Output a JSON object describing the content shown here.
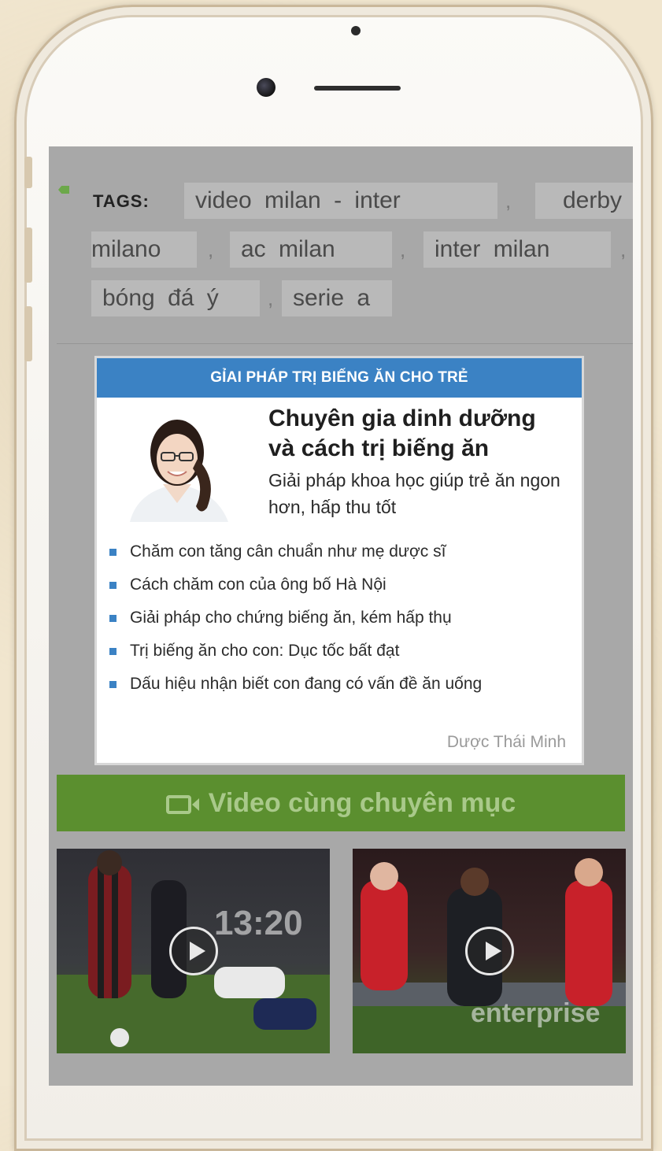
{
  "tags": {
    "label": "TAGS:",
    "items": [
      "video milan - inter",
      "derby milano",
      "ac milan",
      "inter milan",
      "bóng đá ý",
      "serie a"
    ],
    "separator": ","
  },
  "ad": {
    "header": "GỈAI PHÁP TRỊ BIẾNG ĂN CHO TRẺ",
    "title": "Chuyên gia dinh dưỡng và cách trị biếng ăn",
    "subtitle": "Giải pháp khoa học giúp trẻ ăn ngon hơn, hấp thu tốt",
    "links": [
      "Chăm con tăng cân chuẩn như mẹ dược sĩ",
      "Cách chăm con của ông bố Hà Nội",
      "Giải pháp cho chứng biếng ăn, kém hấp thụ",
      "Trị biếng ăn cho con: Dục tốc bất đạt",
      "Dấu hiệu nhận biết con đang có vấn đề ăn uống"
    ],
    "source": "Dược Thái Minh",
    "accent": "#3b82c4"
  },
  "video_section": {
    "title": "Video cùng chuyên mục",
    "icon": "video-camera-icon",
    "bar_color": "#5b8f2f"
  },
  "videos": [
    {
      "icon": "play-icon",
      "scoreboard": "13:20"
    },
    {
      "icon": "play-icon",
      "scoreboard": "enterprise"
    }
  ]
}
